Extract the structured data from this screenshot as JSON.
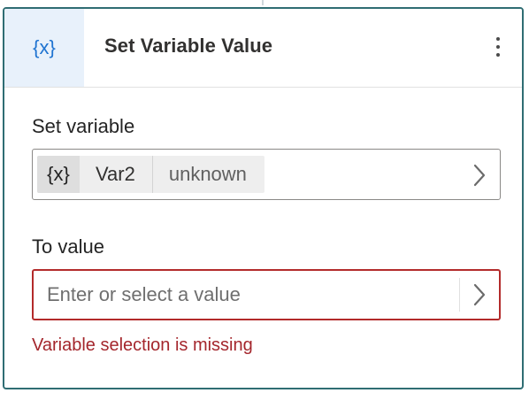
{
  "colors": {
    "accent": "#1f74d1",
    "border": "#2f6d73",
    "error": "#a4262c"
  },
  "card": {
    "icon_text": "{x}",
    "title": "Set Variable Value",
    "more_icon": "more-vertical-icon"
  },
  "set_variable": {
    "label": "Set variable",
    "token_icon_text": "{x}",
    "variable_name": "Var2",
    "variable_type": "unknown",
    "chevron_icon": "chevron-right-icon"
  },
  "to_value": {
    "label": "To value",
    "placeholder": "Enter or select a value",
    "value": "",
    "chevron_icon": "chevron-right-icon",
    "error": "Variable selection is missing"
  }
}
